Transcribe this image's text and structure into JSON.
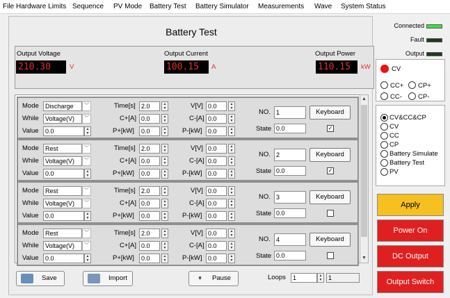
{
  "menu": [
    "File",
    "Hardware Limits",
    "Sequence",
    "PV Mode",
    "Battery Test",
    "Battery Simulator",
    "Measurements",
    "Wave",
    "System Status"
  ],
  "title": "Battery Test",
  "readouts": {
    "voltage": {
      "label": "Output Voltage",
      "value": "210.30",
      "unit": "V"
    },
    "current": {
      "label": "Output Current",
      "value": "100.15",
      "unit": "A"
    },
    "power": {
      "label": "Output Power",
      "value": "110.15",
      "unit": "kW"
    }
  },
  "step_labels": {
    "mode": "Mode",
    "while": "While",
    "value": "Value",
    "time": "Time[s]",
    "v": "V[V]",
    "cplus": "C+[A]",
    "cminus": "C-[A]",
    "pplus": "P+[kW]",
    "pminus": "P-[kW]",
    "no": "NO.",
    "state": "State",
    "keyboard": "Keyboard"
  },
  "steps": [
    {
      "mode": "Discharge",
      "while": "Voltage(V)",
      "value": "0.0",
      "time": "2.0",
      "v": "0.0",
      "cplus": "0.0",
      "cminus": "0.0",
      "pplus": "0.0",
      "pminus": "0.0",
      "no": "1",
      "state": "0.0",
      "checked": true
    },
    {
      "mode": "Rest",
      "while": "Voltage(V)",
      "value": "0.0",
      "time": "2.0",
      "v": "0.0",
      "cplus": "0.0",
      "cminus": "0.0",
      "pplus": "0.0",
      "pminus": "0.0",
      "no": "2",
      "state": "0.0",
      "checked": true
    },
    {
      "mode": "Rest",
      "while": "Voltage(V)",
      "value": "0.0",
      "time": "2.0",
      "v": "0.0",
      "cplus": "0.0",
      "cminus": "0.0",
      "pplus": "0.0",
      "pminus": "0.0",
      "no": "3",
      "state": "0.0",
      "checked": false
    },
    {
      "mode": "Rest",
      "while": "Voltage(V)",
      "value": "0.0",
      "time": "2.0",
      "v": "0.0",
      "cplus": "0.0",
      "cminus": "0.0",
      "pplus": "0.0",
      "pminus": "0.0",
      "no": "4",
      "state": "0.0",
      "checked": false
    }
  ],
  "bottom": {
    "save": "Save",
    "import": "Import",
    "pause": "Pause",
    "loops_label": "Loops",
    "loops_value": "1",
    "loops_display": "1"
  },
  "status": {
    "connected": "Connected",
    "fault": "Fault",
    "output": "Output",
    "led_connected": "#44dd44",
    "led_fault": "#1f3a1f",
    "led_output": "#1f3a1f"
  },
  "mode_group": {
    "cv": "CV",
    "ccplus": "CC+",
    "cpplus": "CP+",
    "ccminus": "CC-",
    "cpminus": "CP-"
  },
  "func_group": [
    "CV&CC&CP",
    "CV",
    "CC",
    "CP",
    "Battery Simulate",
    "Battery Test",
    "PV"
  ],
  "buttons": {
    "apply": "Apply",
    "power_on": "Power On",
    "dc_output": "DC Output",
    "output_switch": "Output Switch"
  },
  "colors": {
    "apply": "#f5c020",
    "red_button": "#e02020",
    "readout_text": "#e03030",
    "cv_indicator": "#ee1111"
  }
}
